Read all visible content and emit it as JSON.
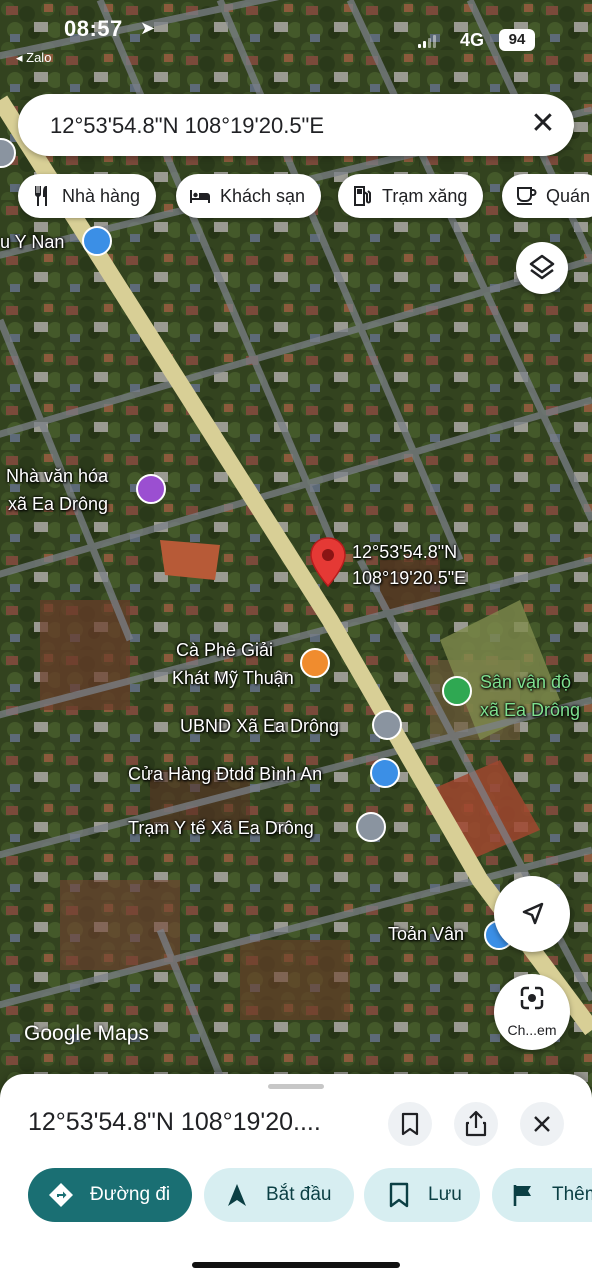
{
  "status_bar": {
    "time": "08:57",
    "back_app": "Zalo",
    "network": "4G",
    "battery": "94"
  },
  "search": {
    "query": "12°53'54.8\"N 108°19'20.5\"E"
  },
  "chips": [
    {
      "label": "Nhà hàng",
      "icon": "restaurant-icon"
    },
    {
      "label": "Khách sạn",
      "icon": "hotel-icon"
    },
    {
      "label": "Trạm xăng",
      "icon": "gas-station-icon"
    },
    {
      "label": "Quán",
      "icon": "cafe-icon"
    }
  ],
  "map": {
    "pin_label_line1": "12°53'54.8\"N",
    "pin_label_line2": "108°19'20.5\"E",
    "labels": {
      "y_nan": "u Y Nan",
      "nha_van_hoa_1": "Nhà văn hóa",
      "nha_van_hoa_2": "xã Ea Drông",
      "ca_phe_1": "Cà Phê Giải",
      "ca_phe_2": "Khát Mỹ Thuận",
      "san_van_dong_1": "Sân vận độ",
      "san_van_dong_2": "xã Ea Drông",
      "ubnd": "UBND Xã Ea Drông",
      "cua_hang": "Cửa Hàng Đtdđ Bình An",
      "tram_y_te": "Trạm Y tế Xã Ea Drông",
      "toan_van": "Toản Vân"
    },
    "logo": "Google Maps",
    "lens_label": "Ch...em"
  },
  "colors": {
    "primary_button": "#1a6f73",
    "secondary_button": "#d7eef1",
    "pin": "#e53935",
    "cafe_poi": "#f08c2e",
    "shopping_poi": "#3b8fe6",
    "culture_poi": "#9b4fd1",
    "sports_poi": "#2fa852",
    "civic_poi": "#8a94a0"
  },
  "sheet": {
    "title": "12°53'54.8\"N 108°19'20....",
    "actions": [
      {
        "label": "Đường đi",
        "icon": "directions-icon"
      },
      {
        "label": "Bắt đầu",
        "icon": "navigation-arrow-icon"
      },
      {
        "label": "Lưu",
        "icon": "bookmark-icon"
      },
      {
        "label": "Thêm",
        "icon": "flag-icon"
      }
    ]
  }
}
